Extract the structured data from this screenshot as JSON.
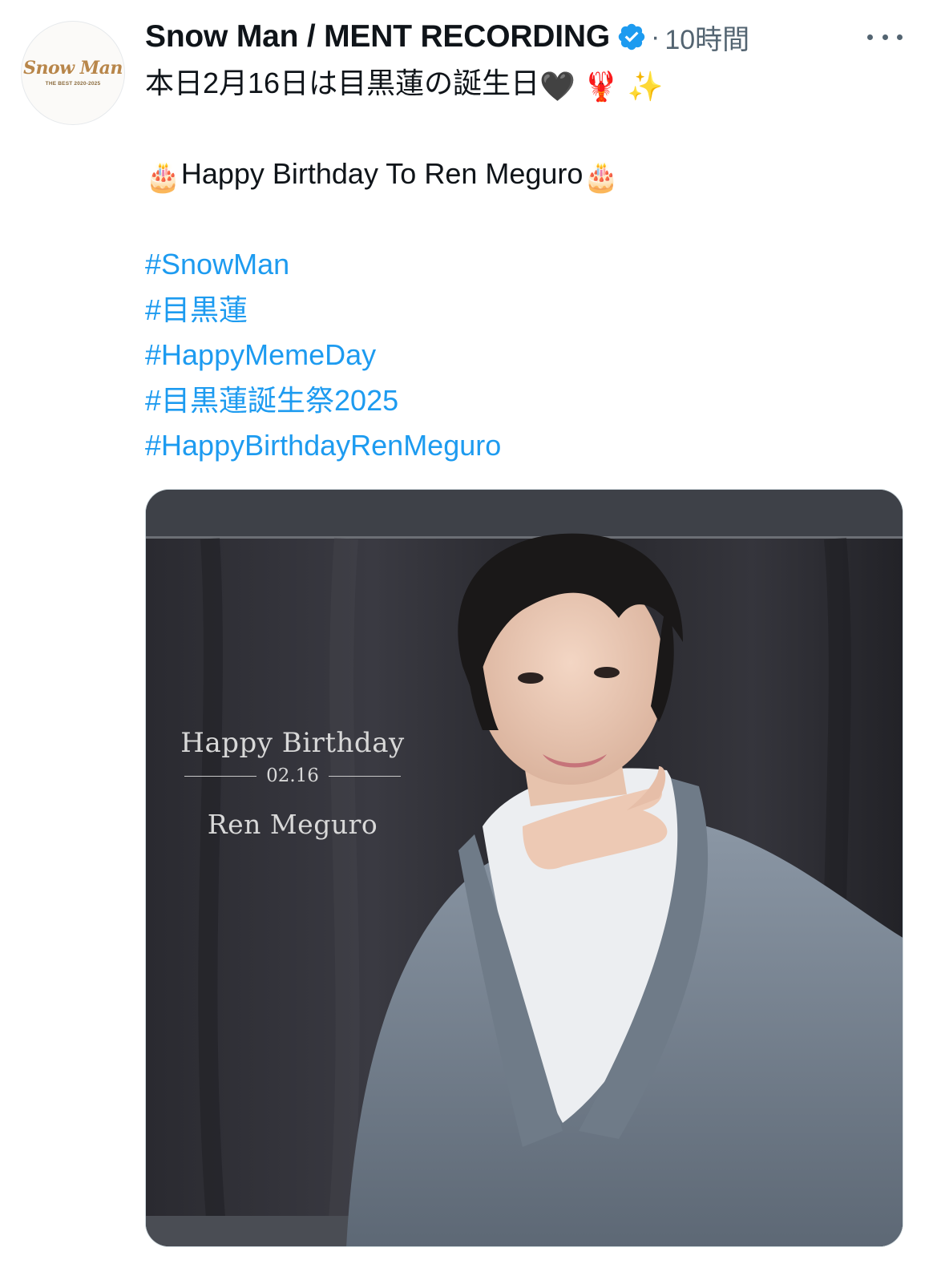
{
  "account": {
    "display_name": "Snow Man / MENT RECORDING",
    "verified_icon": "verified-badge-icon",
    "separator": "·",
    "time_ago": "10時間",
    "avatar_logo": "Snow Man",
    "avatar_subtitle": "THE BEST 2020-2025"
  },
  "more_icon": "more-options-icon",
  "tweet": {
    "line1_text": "本日2月16日は目黒蓮の誕生日",
    "line1_emojis": "🖤 🦞 ✨",
    "line2_prefix_emoji": "🎂",
    "line2_text": "Happy Birthday To Ren Meguro",
    "line2_suffix_emoji": "🎂",
    "hashtags": [
      "#SnowMan",
      "#目黒蓮",
      "#HappyMemeDay",
      "#目黒蓮誕生祭2025",
      "#HappyBirthdayRenMeguro"
    ]
  },
  "photo": {
    "happy_birthday": "Happy Birthday",
    "date": "02.16",
    "name": "Ren Meguro"
  },
  "colors": {
    "hashtag": "#1d9bf0",
    "verified": "#1d9bf0",
    "meta": "#536471",
    "text": "#0f1419"
  }
}
